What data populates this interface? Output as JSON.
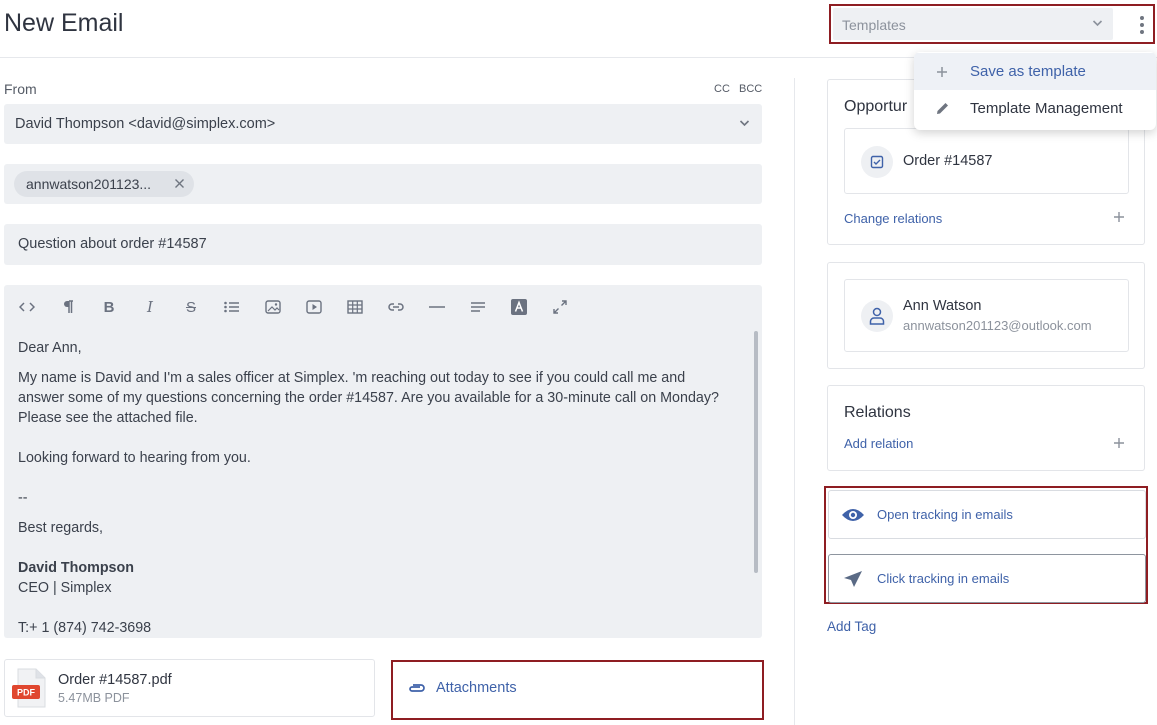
{
  "header": {
    "title": "New Email",
    "templates_placeholder": "Templates"
  },
  "template_menu": {
    "items": [
      {
        "label": "Save as template",
        "icon": "plus-icon"
      },
      {
        "label": "Template Management",
        "icon": "pencil-icon"
      }
    ]
  },
  "form": {
    "from_label": "From",
    "cc_label": "CC",
    "bcc_label": "BCC",
    "from_value": "David Thompson <david@simplex.com>",
    "to_chip": "annwatson201123...",
    "subject": "Question about order #14587"
  },
  "editor": {
    "toolbar": [
      "code-icon",
      "paragraph-icon",
      "bold-icon",
      "italic-icon",
      "strikethrough-icon",
      "bullet-list-icon",
      "image-icon",
      "video-icon",
      "table-icon",
      "link-icon",
      "horizontal-rule-icon",
      "align-icon",
      "font-color-icon",
      "fullscreen-icon"
    ],
    "greeting": "Dear Ann,",
    "paragraph": "My name is David and I'm a sales officer at Simplex. 'm reaching out today to see if you could call me and answer some of my questions concerning the order #14587. Are you available for a 30-minute call on Monday? Please see the attached file.",
    "closing_line": "Looking forward to hearing from you.",
    "separator": "--",
    "regards": "Best regards,",
    "sig_name": "David Thompson",
    "sig_title": "CEO | Simplex",
    "sig_phone": "T:+ 1 (874) 742-3698"
  },
  "attachment": {
    "file_name": "Order #14587.pdf",
    "file_meta": "5.47MB PDF",
    "file_badge": "PDF",
    "button_label": "Attachments"
  },
  "sidebar": {
    "opportunity_title": "Opportur",
    "order_label": "Order #14587",
    "change_relations": "Change relations",
    "contact_name": "Ann Watson",
    "contact_email": "annwatson201123@outlook.com",
    "relations_title": "Relations",
    "add_relation": "Add relation",
    "open_tracking": "Open tracking in emails",
    "click_tracking": "Click tracking in emails",
    "add_tag": "Add Tag"
  },
  "colors": {
    "accent": "#3f62a9",
    "highlight_frame": "#8e1d22",
    "field_bg": "#eef0f3",
    "pdf_red": "#e0472f"
  }
}
